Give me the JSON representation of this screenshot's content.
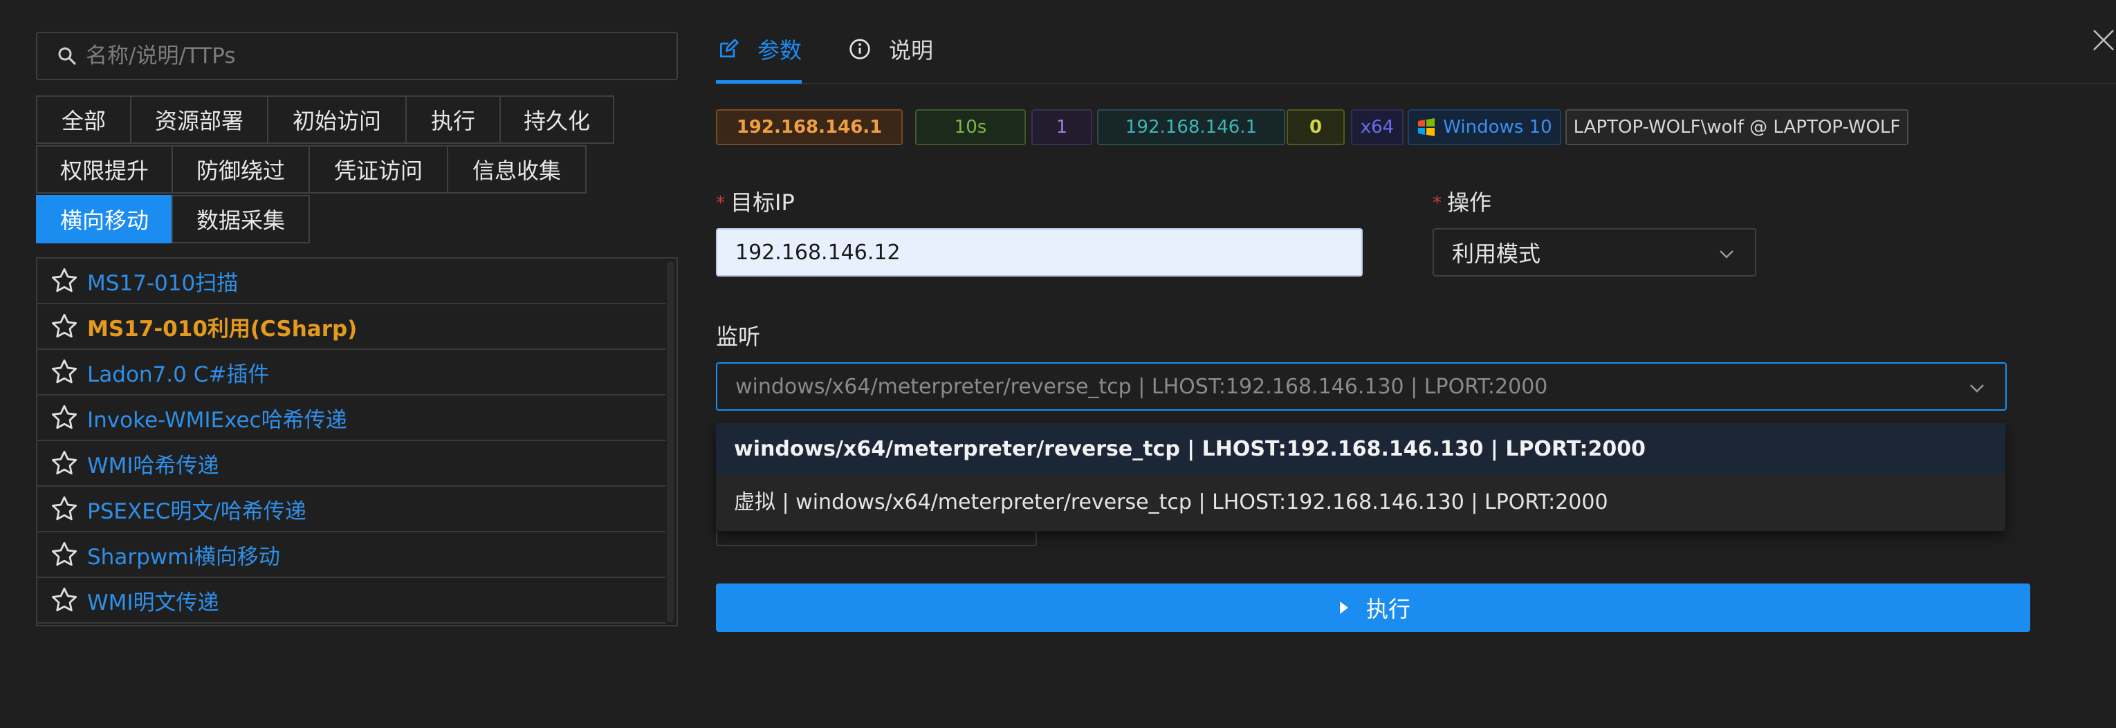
{
  "search": {
    "placeholder": "名称/说明/TTPs"
  },
  "categories": [
    {
      "label": "全部",
      "active": false
    },
    {
      "label": "资源部署",
      "active": false
    },
    {
      "label": "初始访问",
      "active": false
    },
    {
      "label": "执行",
      "active": false
    },
    {
      "label": "持久化",
      "active": false
    },
    {
      "label": "权限提升",
      "active": false
    },
    {
      "label": "防御绕过",
      "active": false
    },
    {
      "label": "凭证访问",
      "active": false
    },
    {
      "label": "信息收集",
      "active": false
    },
    {
      "label": "横向移动",
      "active": true
    },
    {
      "label": "数据采集",
      "active": false
    }
  ],
  "modules": [
    {
      "name": "MS17-010扫描",
      "highlight": false
    },
    {
      "name": "MS17-010利用(CSharp)",
      "highlight": true
    },
    {
      "name": "Ladon7.0 C#插件",
      "highlight": false
    },
    {
      "name": "Invoke-WMIExec哈希传递",
      "highlight": false
    },
    {
      "name": "WMI哈希传递",
      "highlight": false
    },
    {
      "name": "PSEXEC明文/哈希传递",
      "highlight": false
    },
    {
      "name": "Sharpwmi横向移动",
      "highlight": false
    },
    {
      "name": "WMI明文传递",
      "highlight": false
    }
  ],
  "right_tabs": {
    "params": "参数",
    "description": "说明"
  },
  "session": {
    "ip": "192.168.146.1",
    "interval": "10s",
    "pid": "1",
    "internal_ip": "192.168.146.1",
    "count": "0",
    "arch": "x64",
    "os": "Windows 10",
    "user": "LAPTOP-WOLF\\wolf @ LAPTOP-WOLF"
  },
  "form": {
    "target_ip_label": "目标IP",
    "target_ip_value": "192.168.146.12",
    "operation_label": "操作",
    "operation_value": "利用模式",
    "listener_label": "监听",
    "listener_value": "windows/x64/meterpreter/reverse_tcp | LHOST:192.168.146.130 | LPORT:2000",
    "required_mark": "*"
  },
  "listener_options": [
    "windows/x64/meterpreter/reverse_tcp | LHOST:192.168.146.130 | LPORT:2000",
    "虚拟 | windows/x64/meterpreter/reverse_tcp | LHOST:192.168.146.130 | LPORT:2000"
  ],
  "execute_label": "执行",
  "colors": {
    "accent": "#1b8cf0",
    "highlight_module": "#e39a1e",
    "link": "#2f8fe8"
  }
}
